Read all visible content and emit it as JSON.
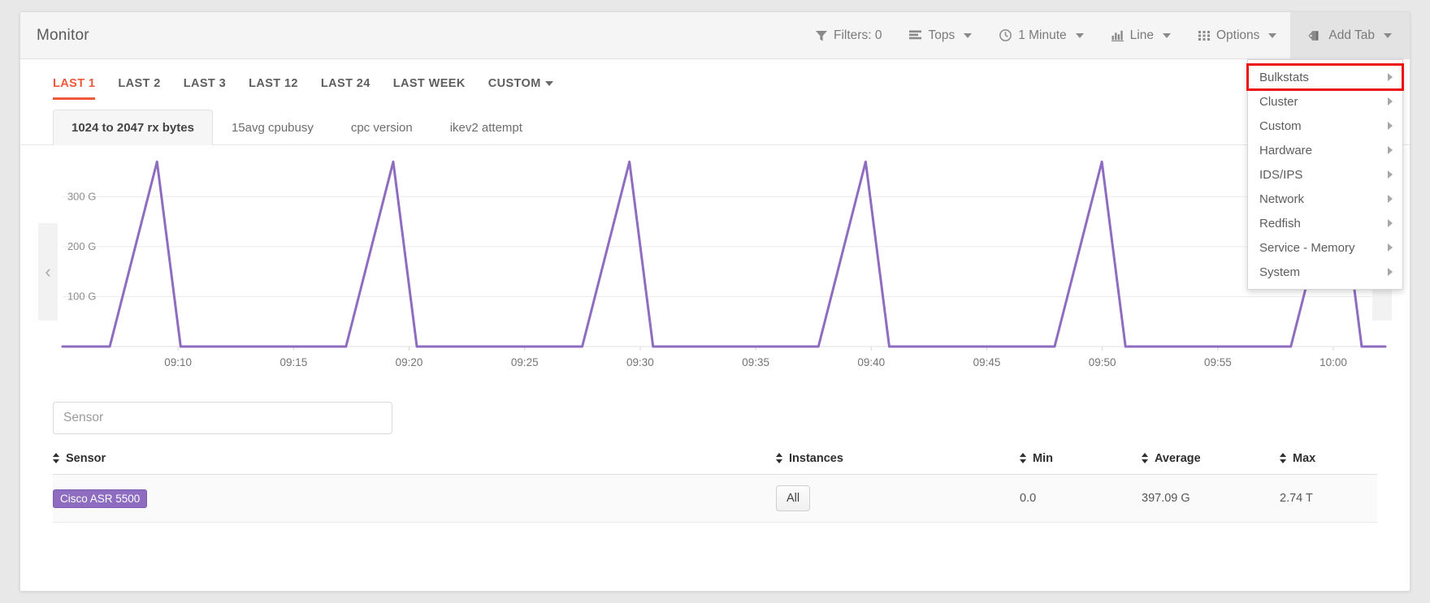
{
  "header": {
    "title": "Monitor",
    "tools": [
      {
        "id": "filters",
        "icon": "filter-icon",
        "label": "Filters: 0",
        "caret": false
      },
      {
        "id": "tops",
        "icon": "list-icon",
        "label": "Tops",
        "caret": true
      },
      {
        "id": "interval",
        "icon": "clock-icon",
        "label": "1 Minute",
        "caret": true
      },
      {
        "id": "charttype",
        "icon": "bar-chart-icon",
        "label": "Line",
        "caret": true
      },
      {
        "id": "options",
        "icon": "grid-icon",
        "label": "Options",
        "caret": true
      },
      {
        "id": "addtab",
        "icon": "tag-icon",
        "label": "Add Tab",
        "caret": true
      }
    ]
  },
  "ranges": {
    "items": [
      {
        "label": "LAST 1",
        "selected": true,
        "caret": false
      },
      {
        "label": "LAST 2",
        "selected": false,
        "caret": false
      },
      {
        "label": "LAST 3",
        "selected": false,
        "caret": false
      },
      {
        "label": "LAST 12",
        "selected": false,
        "caret": false
      },
      {
        "label": "LAST 24",
        "selected": false,
        "caret": false
      },
      {
        "label": "LAST WEEK",
        "selected": false,
        "caret": false
      },
      {
        "label": "CUSTOM",
        "selected": false,
        "caret": true
      }
    ]
  },
  "metric_tabs": [
    {
      "label": "1024 to 2047 rx bytes",
      "selected": true
    },
    {
      "label": "15avg cpubusy",
      "selected": false
    },
    {
      "label": "cpc version",
      "selected": false
    },
    {
      "label": "ikev2 attempt",
      "selected": false
    }
  ],
  "chart_nav": {
    "left_icon": "chevron-left-icon",
    "right_icon": "chevron-right-icon"
  },
  "search": {
    "placeholder": "Sensor",
    "value": ""
  },
  "table": {
    "columns": [
      {
        "key": "sensor",
        "label": "Sensor",
        "sortable": true
      },
      {
        "key": "instances",
        "label": "Instances",
        "sortable": true
      },
      {
        "key": "min",
        "label": "Min",
        "sortable": true
      },
      {
        "key": "average",
        "label": "Average",
        "sortable": true
      },
      {
        "key": "max",
        "label": "Max",
        "sortable": true
      }
    ],
    "rows": [
      {
        "sensor": "Cisco ASR 5500",
        "instances": "All",
        "min": "0.0",
        "average": "397.09 G",
        "max": "2.74 T"
      }
    ]
  },
  "add_tab_menu": {
    "items": [
      {
        "label": "Bulkstats",
        "highlighted": true,
        "submenu": true
      },
      {
        "label": "Cluster",
        "highlighted": false,
        "submenu": true
      },
      {
        "label": "Custom",
        "highlighted": false,
        "submenu": true
      },
      {
        "label": "Hardware",
        "highlighted": false,
        "submenu": true
      },
      {
        "label": "IDS/IPS",
        "highlighted": false,
        "submenu": true
      },
      {
        "label": "Network",
        "highlighted": false,
        "submenu": true
      },
      {
        "label": "Redfish",
        "highlighted": false,
        "submenu": true
      },
      {
        "label": "Service - Memory",
        "highlighted": false,
        "submenu": true
      },
      {
        "label": "System",
        "highlighted": false,
        "submenu": true
      }
    ]
  },
  "colors": {
    "accent": "#f0583a",
    "series": "#8e6cc0",
    "highlight": "#ee1111",
    "chip": "#8e6cc0"
  },
  "chart_data": {
    "type": "line",
    "title": "1024 to 2047 rx bytes",
    "xlabel": "",
    "ylabel": "",
    "grid": true,
    "legend": false,
    "xtick_labels": [
      "09:10",
      "09:15",
      "09:20",
      "09:25",
      "09:30",
      "09:35",
      "09:40",
      "09:45",
      "09:50",
      "09:55",
      "10:00"
    ],
    "ytick_labels": [
      "100 G",
      "200 G",
      "300 G"
    ],
    "ytick_values": [
      100,
      200,
      300
    ],
    "ylim": [
      0,
      390
    ],
    "xlim": [
      0,
      56
    ],
    "series": [
      {
        "name": "Cisco ASR 5500",
        "color": "#8e6cc0",
        "x": [
          0,
          2,
          3,
          4,
          5,
          12,
          13,
          14,
          15,
          22,
          23,
          24,
          25,
          32,
          33,
          34,
          35,
          42,
          43,
          44,
          45,
          52,
          53,
          54,
          55,
          56
        ],
        "y": [
          0,
          0,
          185,
          370,
          0,
          0,
          185,
          370,
          0,
          0,
          185,
          370,
          0,
          0,
          185,
          370,
          0,
          0,
          185,
          370,
          0,
          0,
          185,
          370,
          0,
          0
        ]
      }
    ]
  }
}
